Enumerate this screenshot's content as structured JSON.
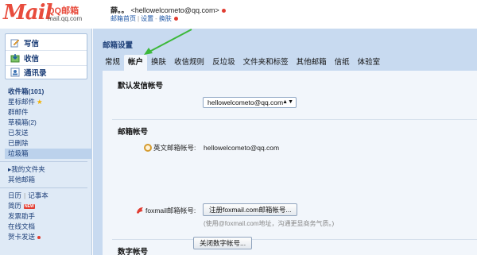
{
  "header": {
    "logo_big": "Mail",
    "logo_cn": "QQ邮箱",
    "logo_domain": "mail.qq.com",
    "user_name": "薛。。",
    "user_email": "<hellowelcometo@qq.com>",
    "links": [
      "邮箱首页",
      "设置",
      "换肤"
    ]
  },
  "sidebar": {
    "actions": [
      {
        "label": "写信",
        "icon": "pencil-icon"
      },
      {
        "label": "收信",
        "icon": "inbox-icon"
      },
      {
        "label": "通讯录",
        "icon": "contacts-icon"
      }
    ],
    "folders": [
      {
        "label": "收件箱(101)",
        "bold": true
      },
      {
        "label": "星标邮件",
        "star": true
      },
      {
        "label": "群邮件"
      },
      {
        "label": "草稿箱(2)"
      },
      {
        "label": "已发送"
      },
      {
        "label": "已删除"
      },
      {
        "label": "垃圾箱",
        "active": true
      }
    ],
    "my_folders": "▸我的文件夹",
    "other_mailbox": "其他邮箱",
    "calendar": "日历",
    "notes": "记事本",
    "resume": "简历",
    "new_badge": "NEW",
    "tools": [
      "发票助手",
      "在线文档",
      "贺卡发送"
    ]
  },
  "main": {
    "title": "邮箱设置",
    "tabs": [
      "常规",
      "帐户",
      "换肤",
      "收信规则",
      "反垃圾",
      "文件夹和标签",
      "其他邮箱",
      "信纸",
      "体验室"
    ],
    "active_tab": 1,
    "section_sender": "默认发信帐号",
    "sender_value": "hellowelcometo@qq.com",
    "section_accounts": "邮箱帐号",
    "english_label": "英文邮箱帐号:",
    "english_value": "hellowelcometo@qq.com",
    "foxmail_label": "foxmail邮箱帐号:",
    "foxmail_button": "注册foxmail.com邮箱帐号...",
    "foxmail_hint": "(使用@foxmail.com地址，沟通更显商务气质。)",
    "section_digital": "数字帐号",
    "digital_button": "关闭数字帐号..."
  },
  "colors": {
    "accent": "#e84c3d",
    "sidebar_bg": "#dfeaf6",
    "main_bg": "#c8daf0",
    "panel_bg": "#f2f6fb",
    "link": "#1d56a5",
    "arrow": "#3cb83a"
  }
}
